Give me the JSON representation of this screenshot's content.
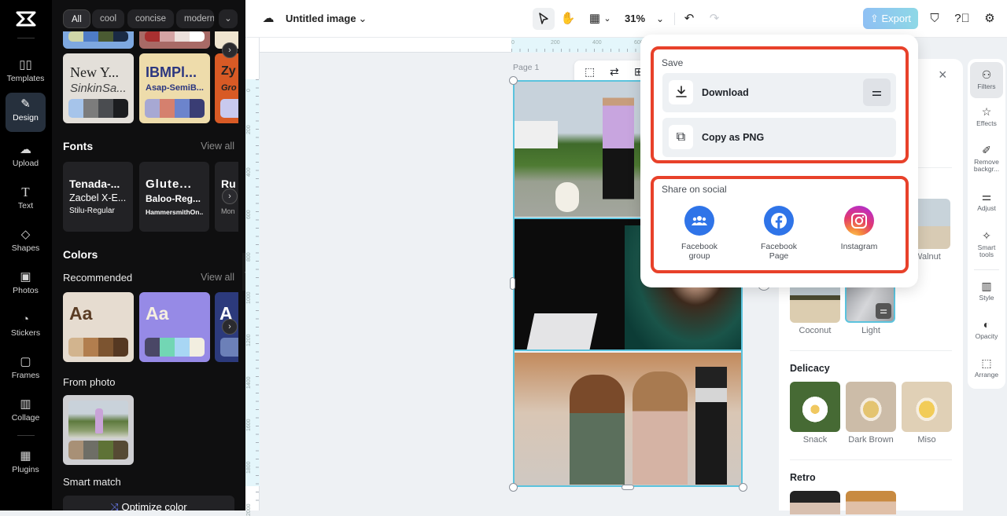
{
  "app": {
    "logo": "capcut-logo"
  },
  "rail": {
    "items": [
      {
        "label": "Templates",
        "icon": "templates-icon",
        "glyph": "▯▯"
      },
      {
        "label": "Design",
        "icon": "design-icon",
        "glyph": "✎",
        "active": true
      },
      {
        "label": "Upload",
        "icon": "upload-cloud-icon",
        "glyph": "☁"
      },
      {
        "label": "Text",
        "icon": "text-icon",
        "glyph": "T"
      },
      {
        "label": "Shapes",
        "icon": "shapes-icon",
        "glyph": "◇"
      },
      {
        "label": "Photos",
        "icon": "photos-icon",
        "glyph": "▣"
      },
      {
        "label": "Stickers",
        "icon": "stickers-icon",
        "glyph": "◔"
      },
      {
        "label": "Frames",
        "icon": "frames-icon",
        "glyph": "▢"
      },
      {
        "label": "Collage",
        "icon": "collage-icon",
        "glyph": "▥"
      },
      {
        "label": "Plugins",
        "icon": "plugins-icon",
        "glyph": "▦"
      }
    ]
  },
  "panel": {
    "chips": [
      "All",
      "cool",
      "concise",
      "modern"
    ],
    "style_cards": [
      {
        "title": "New Y...",
        "subtitle": "SinkinSa...",
        "bg": "#e3dfd9",
        "fg": "#222",
        "sub_fg": "#444",
        "swatch": [
          "#a6c4ea",
          "#7c7c7c",
          "#4a4c50",
          "#1c1d20"
        ]
      },
      {
        "title": "IBMPl...",
        "subtitle": "Asap-SemiB...",
        "bg": "#eedcab",
        "fg": "#2b3680",
        "sub_fg": "#2b3680",
        "swatch": [
          "#a7a8d3",
          "#d5806e",
          "#6c84cc",
          "#3a3d74"
        ]
      },
      {
        "title": "Zy",
        "subtitle": "Gro",
        "bg": "#d85a25",
        "fg": "#222",
        "sub_fg": "#222",
        "swatch": [
          "#c8c9ee",
          "#c8c9ee",
          "#c8c9ee",
          "#c8c9ee"
        ]
      }
    ],
    "fonts": {
      "title": "Fonts",
      "view_all": "View all",
      "cards": [
        {
          "line1": "Tenada-...",
          "line2": "Zacbel X-E...",
          "line3": "Stilu-Regular"
        },
        {
          "line1": "Glute...",
          "line2": "Baloo-Reg...",
          "line3": "HammersmithOn..."
        },
        {
          "line1": "Ru",
          "line2": "",
          "line3": "Mon"
        }
      ]
    },
    "colors": {
      "title": "Colors",
      "recommended": "Recommended",
      "view_all": "View all",
      "cards": [
        {
          "label": "Aa",
          "bg": "#e6dcd0",
          "fg": "#5a3c24",
          "swatch": [
            "#d2b48e",
            "#b27e4e",
            "#7c5430",
            "#553822"
          ]
        },
        {
          "label": "Aa",
          "bg": "#968ae6",
          "fg": "#f5efe0",
          "swatch": [
            "#4a4766",
            "#72d6b4",
            "#a8d6f4",
            "#f2eee0"
          ]
        },
        {
          "label": "A",
          "bg": "#2c3a7c",
          "fg": "#fff",
          "swatch": [
            "#6c80b8",
            "#6c80b8",
            "#6c80b8",
            "#6c80b8"
          ]
        }
      ],
      "from_photo": "From photo",
      "photo_swatch": [
        "#a89076",
        "#6e6e66",
        "#5e7236",
        "#564a34"
      ],
      "smart_match": "Smart match",
      "optimize": "Optimize color"
    }
  },
  "topbar": {
    "title": "Untitled image",
    "zoom": "31%",
    "export": "Export"
  },
  "rulers": {
    "h_ticks": [
      "0",
      "200",
      "400",
      "600"
    ],
    "v_ticks": [
      "0",
      "200",
      "400",
      "600",
      "800",
      "1000",
      "1200",
      "1400",
      "1600",
      "1800",
      "2000"
    ]
  },
  "canvas": {
    "page_label": "Page 1"
  },
  "export_popup": {
    "save_title": "Save",
    "download": "Download",
    "copy_png": "Copy as PNG",
    "share_title": "Share on social",
    "social": [
      {
        "line1": "Facebook",
        "line2": "group",
        "icon": "facebook-group-icon",
        "color": "#2f74e8"
      },
      {
        "line1": "Facebook",
        "line2": "Page",
        "icon": "facebook-icon",
        "color": "#2f74e8"
      },
      {
        "line1": "Instagram",
        "line2": "",
        "icon": "instagram-icon",
        "color": "#d8307a"
      }
    ]
  },
  "filters": {
    "partial_label": "Walnut",
    "row2": [
      {
        "label": "Coconut"
      },
      {
        "label": "Light",
        "selected": true
      }
    ],
    "groups": [
      {
        "title": "Delicacy",
        "items": [
          "Snack",
          "Dark Brown",
          "Miso"
        ]
      },
      {
        "title": "Retro",
        "items": []
      }
    ]
  },
  "tools": [
    {
      "label": "Filters",
      "icon": "filters-icon",
      "glyph": "⚇",
      "active": true
    },
    {
      "label": "Effects",
      "icon": "effects-icon",
      "glyph": "☆"
    },
    {
      "label": "Remove backgr...",
      "icon": "remove-background-icon",
      "glyph": "✐"
    },
    {
      "label": "Adjust",
      "icon": "adjust-icon",
      "glyph": "⚌"
    },
    {
      "label": "Smart tools",
      "icon": "smart-tools-icon",
      "glyph": "✧"
    },
    {
      "label": "Style",
      "icon": "style-icon",
      "glyph": "▥"
    },
    {
      "label": "Opacity",
      "icon": "opacity-icon",
      "glyph": "◐"
    },
    {
      "label": "Arrange",
      "icon": "arrange-icon",
      "glyph": "⬚"
    }
  ]
}
